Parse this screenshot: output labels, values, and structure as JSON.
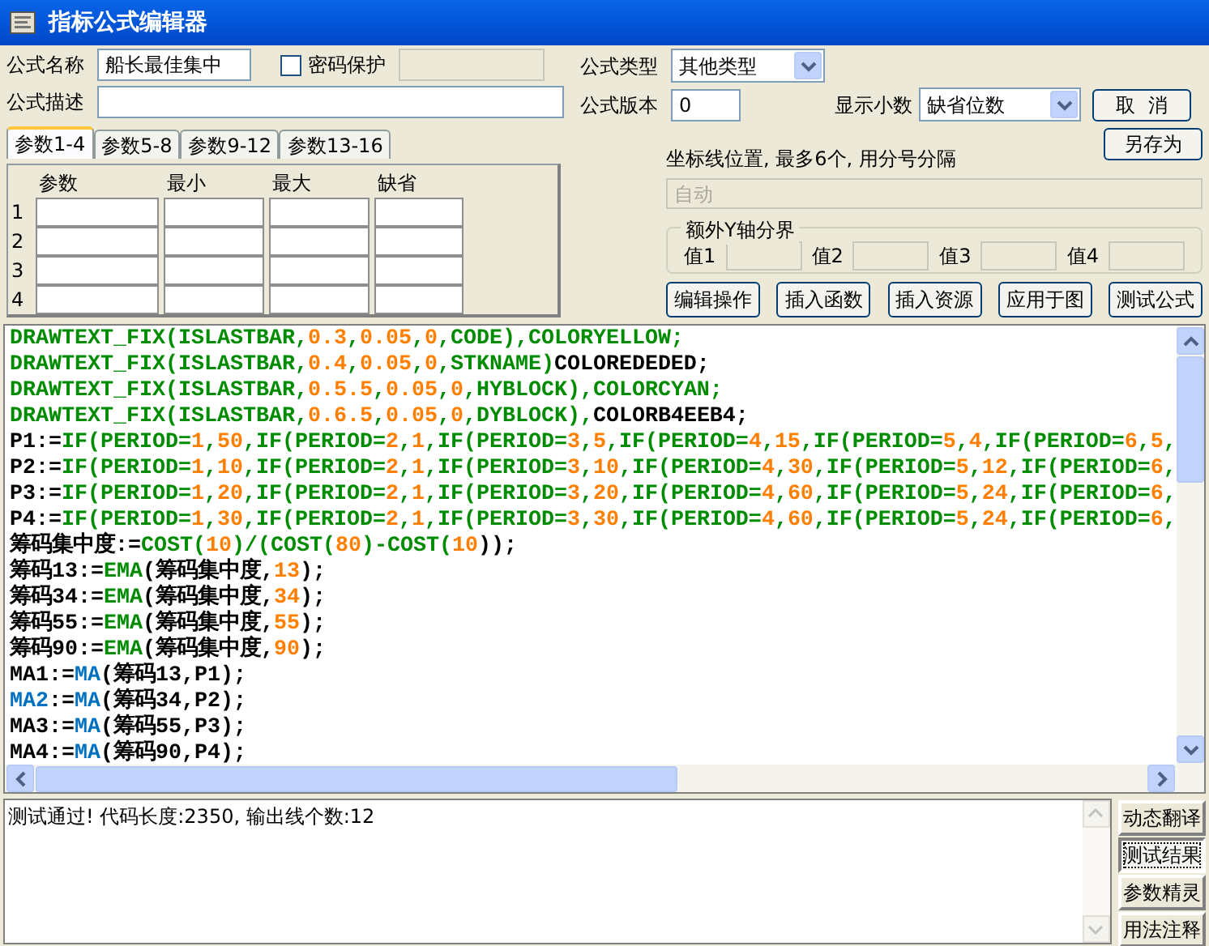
{
  "window": {
    "title": "指标公式编辑器"
  },
  "form": {
    "name_label": "公式名称",
    "name_value": "船长最佳集中",
    "password": {
      "label": "密码保护",
      "checked": false
    },
    "type_label": "公式类型",
    "type_value": "其他类型",
    "desc_label": "公式描述",
    "version_label": "公式版本",
    "version_value": "0",
    "decimals_label": "显示小数",
    "decimals_value": "缺省位数",
    "cancel": "取  消",
    "save_as": "另存为"
  },
  "param_tabs": [
    {
      "label": "参数1-4",
      "selected": true
    },
    {
      "label": "参数5-8",
      "selected": false
    },
    {
      "label": "参数9-12",
      "selected": false
    },
    {
      "label": "参数13-16",
      "selected": false
    }
  ],
  "param_table": {
    "columns": [
      "参数",
      "最小",
      "最大",
      "缺省"
    ],
    "rows": [
      "1",
      "2",
      "3",
      "4"
    ]
  },
  "axis": {
    "label": "坐标线位置, 最多6个, 用分号分隔",
    "value": "自动",
    "disabled": true
  },
  "y_bounds": {
    "title": "额外Y轴分界",
    "fields": [
      "值1",
      "值2",
      "值3",
      "值4"
    ]
  },
  "actions": [
    "编辑操作",
    "插入函数",
    "插入资源",
    "应用于图",
    "测试公式"
  ],
  "code": [
    [
      {
        "kind": "kw",
        "text": "DRAWTEXT_FIX(ISLASTBAR,"
      },
      {
        "kind": "num",
        "text": "0.3"
      },
      {
        "kind": "kw",
        "text": ","
      },
      {
        "kind": "num",
        "text": "0.05"
      },
      {
        "kind": "kw",
        "text": ","
      },
      {
        "kind": "num",
        "text": "0"
      },
      {
        "kind": "kw",
        "text": ",CODE),COLORYELLOW;"
      }
    ],
    [
      {
        "kind": "kw",
        "text": "DRAWTEXT_FIX(ISLASTBAR,"
      },
      {
        "kind": "num",
        "text": "0.4"
      },
      {
        "kind": "kw",
        "text": ","
      },
      {
        "kind": "num",
        "text": "0.05"
      },
      {
        "kind": "kw",
        "text": ","
      },
      {
        "kind": "num",
        "text": "0"
      },
      {
        "kind": "kw",
        "text": ",STKNAME)"
      },
      {
        "kind": "plain",
        "text": "COLOREDEDED;"
      }
    ],
    [
      {
        "kind": "kw",
        "text": "DRAWTEXT_FIX(ISLASTBAR,"
      },
      {
        "kind": "num",
        "text": "0.5.5"
      },
      {
        "kind": "kw",
        "text": ","
      },
      {
        "kind": "num",
        "text": "0.05"
      },
      {
        "kind": "kw",
        "text": ","
      },
      {
        "kind": "num",
        "text": "0"
      },
      {
        "kind": "kw",
        "text": ",HYBLOCK),COLORCYAN;"
      }
    ],
    [
      {
        "kind": "kw",
        "text": "DRAWTEXT_FIX(ISLASTBAR,"
      },
      {
        "kind": "num",
        "text": "0.6.5"
      },
      {
        "kind": "kw",
        "text": ","
      },
      {
        "kind": "num",
        "text": "0.05"
      },
      {
        "kind": "kw",
        "text": ","
      },
      {
        "kind": "num",
        "text": "0"
      },
      {
        "kind": "kw",
        "text": ",DYBLOCK),"
      },
      {
        "kind": "plain",
        "text": "COLORB4EEB4;"
      }
    ],
    [
      {
        "kind": "plain",
        "text": "P1:="
      },
      {
        "kind": "kw",
        "text": "IF(PERIOD="
      },
      {
        "kind": "num",
        "text": "1"
      },
      {
        "kind": "kw",
        "text": ","
      },
      {
        "kind": "num",
        "text": "50"
      },
      {
        "kind": "kw",
        "text": ",IF(PERIOD="
      },
      {
        "kind": "num",
        "text": "2"
      },
      {
        "kind": "kw",
        "text": ","
      },
      {
        "kind": "num",
        "text": "1"
      },
      {
        "kind": "kw",
        "text": ",IF(PERIOD="
      },
      {
        "kind": "num",
        "text": "3"
      },
      {
        "kind": "kw",
        "text": ","
      },
      {
        "kind": "num",
        "text": "5"
      },
      {
        "kind": "kw",
        "text": ",IF(PERIOD="
      },
      {
        "kind": "num",
        "text": "4"
      },
      {
        "kind": "kw",
        "text": ","
      },
      {
        "kind": "num",
        "text": "15"
      },
      {
        "kind": "kw",
        "text": ",IF(PERIOD="
      },
      {
        "kind": "num",
        "text": "5"
      },
      {
        "kind": "kw",
        "text": ","
      },
      {
        "kind": "num",
        "text": "4"
      },
      {
        "kind": "kw",
        "text": ",IF(PERIOD="
      },
      {
        "kind": "num",
        "text": "6"
      },
      {
        "kind": "kw",
        "text": ","
      },
      {
        "kind": "num",
        "text": "5"
      },
      {
        "kind": "kw",
        "text": ","
      }
    ],
    [
      {
        "kind": "plain",
        "text": "P2:="
      },
      {
        "kind": "kw",
        "text": "IF(PERIOD="
      },
      {
        "kind": "num",
        "text": "1"
      },
      {
        "kind": "kw",
        "text": ","
      },
      {
        "kind": "num",
        "text": "10"
      },
      {
        "kind": "kw",
        "text": ",IF(PERIOD="
      },
      {
        "kind": "num",
        "text": "2"
      },
      {
        "kind": "kw",
        "text": ","
      },
      {
        "kind": "num",
        "text": "1"
      },
      {
        "kind": "kw",
        "text": ",IF(PERIOD="
      },
      {
        "kind": "num",
        "text": "3"
      },
      {
        "kind": "kw",
        "text": ","
      },
      {
        "kind": "num",
        "text": "10"
      },
      {
        "kind": "kw",
        "text": ",IF(PERIOD="
      },
      {
        "kind": "num",
        "text": "4"
      },
      {
        "kind": "kw",
        "text": ","
      },
      {
        "kind": "num",
        "text": "30"
      },
      {
        "kind": "kw",
        "text": ",IF(PERIOD="
      },
      {
        "kind": "num",
        "text": "5"
      },
      {
        "kind": "kw",
        "text": ","
      },
      {
        "kind": "num",
        "text": "12"
      },
      {
        "kind": "kw",
        "text": ",IF(PERIOD="
      },
      {
        "kind": "num",
        "text": "6"
      },
      {
        "kind": "kw",
        "text": ","
      }
    ],
    [
      {
        "kind": "plain",
        "text": "P3:="
      },
      {
        "kind": "kw",
        "text": "IF(PERIOD="
      },
      {
        "kind": "num",
        "text": "1"
      },
      {
        "kind": "kw",
        "text": ","
      },
      {
        "kind": "num",
        "text": "20"
      },
      {
        "kind": "kw",
        "text": ",IF(PERIOD="
      },
      {
        "kind": "num",
        "text": "2"
      },
      {
        "kind": "kw",
        "text": ","
      },
      {
        "kind": "num",
        "text": "1"
      },
      {
        "kind": "kw",
        "text": ",IF(PERIOD="
      },
      {
        "kind": "num",
        "text": "3"
      },
      {
        "kind": "kw",
        "text": ","
      },
      {
        "kind": "num",
        "text": "20"
      },
      {
        "kind": "kw",
        "text": ",IF(PERIOD="
      },
      {
        "kind": "num",
        "text": "4"
      },
      {
        "kind": "kw",
        "text": ","
      },
      {
        "kind": "num",
        "text": "60"
      },
      {
        "kind": "kw",
        "text": ",IF(PERIOD="
      },
      {
        "kind": "num",
        "text": "5"
      },
      {
        "kind": "kw",
        "text": ","
      },
      {
        "kind": "num",
        "text": "24"
      },
      {
        "kind": "kw",
        "text": ",IF(PERIOD="
      },
      {
        "kind": "num",
        "text": "6"
      },
      {
        "kind": "kw",
        "text": ","
      }
    ],
    [
      {
        "kind": "plain",
        "text": "P4:="
      },
      {
        "kind": "kw",
        "text": "IF(PERIOD="
      },
      {
        "kind": "num",
        "text": "1"
      },
      {
        "kind": "kw",
        "text": ","
      },
      {
        "kind": "num",
        "text": "30"
      },
      {
        "kind": "kw",
        "text": ",IF(PERIOD="
      },
      {
        "kind": "num",
        "text": "2"
      },
      {
        "kind": "kw",
        "text": ","
      },
      {
        "kind": "num",
        "text": "1"
      },
      {
        "kind": "kw",
        "text": ",IF(PERIOD="
      },
      {
        "kind": "num",
        "text": "3"
      },
      {
        "kind": "kw",
        "text": ","
      },
      {
        "kind": "num",
        "text": "30"
      },
      {
        "kind": "kw",
        "text": ",IF(PERIOD="
      },
      {
        "kind": "num",
        "text": "4"
      },
      {
        "kind": "kw",
        "text": ","
      },
      {
        "kind": "num",
        "text": "60"
      },
      {
        "kind": "kw",
        "text": ",IF(PERIOD="
      },
      {
        "kind": "num",
        "text": "5"
      },
      {
        "kind": "kw",
        "text": ","
      },
      {
        "kind": "num",
        "text": "24"
      },
      {
        "kind": "kw",
        "text": ",IF(PERIOD="
      },
      {
        "kind": "num",
        "text": "6"
      },
      {
        "kind": "kw",
        "text": ","
      }
    ],
    [
      {
        "kind": "plain",
        "text": "筹码集中度:="
      },
      {
        "kind": "kw",
        "text": "COST("
      },
      {
        "kind": "num",
        "text": "10"
      },
      {
        "kind": "kw",
        "text": ")/(COST("
      },
      {
        "kind": "num",
        "text": "80"
      },
      {
        "kind": "kw",
        "text": ")-COST("
      },
      {
        "kind": "num",
        "text": "10"
      },
      {
        "kind": "plain",
        "text": "));"
      }
    ],
    [
      {
        "kind": "plain",
        "text": "筹码13:="
      },
      {
        "kind": "kw",
        "text": "EMA"
      },
      {
        "kind": "plain",
        "text": "(筹码集中度,"
      },
      {
        "kind": "num",
        "text": "13"
      },
      {
        "kind": "plain",
        "text": ");"
      }
    ],
    [
      {
        "kind": "plain",
        "text": "筹码34:="
      },
      {
        "kind": "kw",
        "text": "EMA"
      },
      {
        "kind": "plain",
        "text": "(筹码集中度,"
      },
      {
        "kind": "num",
        "text": "34"
      },
      {
        "kind": "plain",
        "text": ");"
      }
    ],
    [
      {
        "kind": "plain",
        "text": "筹码55:="
      },
      {
        "kind": "kw",
        "text": "EMA"
      },
      {
        "kind": "plain",
        "text": "(筹码集中度,"
      },
      {
        "kind": "num",
        "text": "55"
      },
      {
        "kind": "plain",
        "text": ");"
      }
    ],
    [
      {
        "kind": "plain",
        "text": "筹码90:="
      },
      {
        "kind": "kw",
        "text": "EMA"
      },
      {
        "kind": "plain",
        "text": "(筹码集中度,"
      },
      {
        "kind": "num",
        "text": "90"
      },
      {
        "kind": "plain",
        "text": ");"
      }
    ],
    [
      {
        "kind": "plain",
        "text": "MA1:="
      },
      {
        "kind": "fn",
        "text": "MA"
      },
      {
        "kind": "plain",
        "text": "(筹码13,P1);"
      }
    ],
    [
      {
        "kind": "fn",
        "text": "MA2"
      },
      {
        "kind": "plain",
        "text": ":="
      },
      {
        "kind": "fn",
        "text": "MA"
      },
      {
        "kind": "plain",
        "text": "(筹码34,P2);"
      }
    ],
    [
      {
        "kind": "plain",
        "text": "MA3:="
      },
      {
        "kind": "fn",
        "text": "MA"
      },
      {
        "kind": "plain",
        "text": "(筹码55,P3);"
      }
    ],
    [
      {
        "kind": "plain",
        "text": "MA4:="
      },
      {
        "kind": "fn",
        "text": "MA"
      },
      {
        "kind": "plain",
        "text": "(筹码90,P4);"
      }
    ]
  ],
  "output": {
    "text": "测试通过! 代码长度:2350, 输出线个数:12"
  },
  "side_buttons": [
    {
      "label": "动态翻译",
      "selected": false
    },
    {
      "label": "测试结果",
      "selected": true
    },
    {
      "label": "参数精灵",
      "selected": false
    },
    {
      "label": "用法注释",
      "selected": false
    }
  ]
}
